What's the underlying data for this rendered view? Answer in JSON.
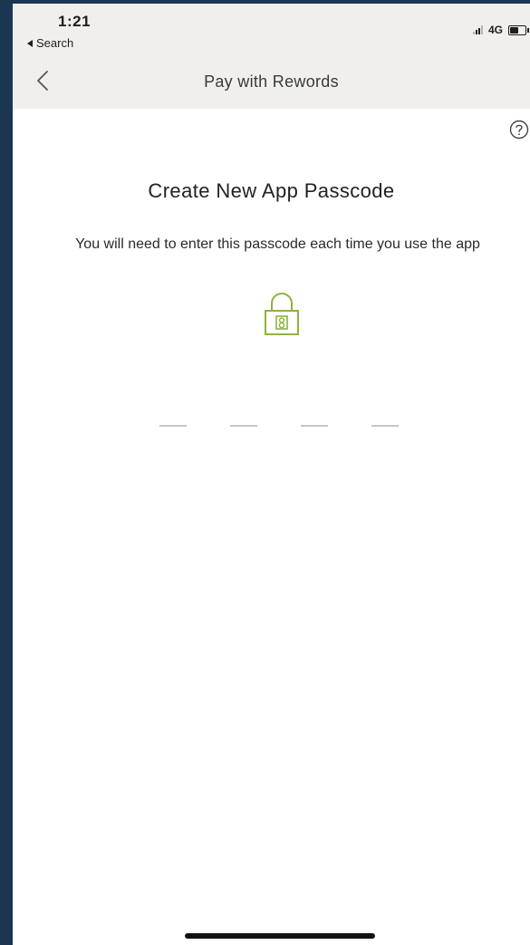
{
  "status_bar": {
    "time": "1:21",
    "back_label": "Search",
    "network": "4G"
  },
  "nav": {
    "title": "Pay with Rewords"
  },
  "main": {
    "heading": "Create New App Passcode",
    "subtitle": "You will need to enter this passcode each time you use the app",
    "passcode_length": 4
  },
  "colors": {
    "lock_accent": "#8db33e",
    "header_background": "#f0efed",
    "outer_background": "#1b3651"
  },
  "icons": {
    "back": "chevron-left-icon",
    "help": "question-circle-icon",
    "lock": "padlock-icon"
  }
}
